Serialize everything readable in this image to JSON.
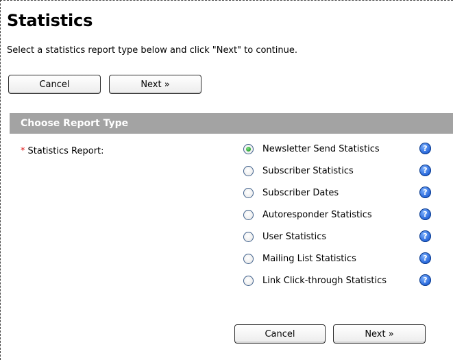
{
  "page": {
    "title": "Statistics",
    "intro": "Select a statistics report type below and click \"Next\" to continue."
  },
  "buttons": {
    "cancel": "Cancel",
    "next": "Next »"
  },
  "section": {
    "header": "Choose Report Type",
    "required_marker": "*",
    "field_label": "Statistics Report:",
    "selected_value": "Newsletter Send Statistics",
    "options": [
      {
        "label": "Newsletter Send Statistics",
        "checked": true
      },
      {
        "label": "Subscriber Statistics",
        "checked": false
      },
      {
        "label": "Subscriber Dates",
        "checked": false
      },
      {
        "label": "Autoresponder Statistics",
        "checked": false
      },
      {
        "label": "User Statistics",
        "checked": false
      },
      {
        "label": "Mailing List Statistics",
        "checked": false
      },
      {
        "label": "Link Click-through Statistics",
        "checked": false
      }
    ],
    "help_glyph": "?"
  },
  "icons": {
    "help": "help-icon",
    "radio": "radio-button"
  },
  "colors": {
    "section_header_bg": "#a3a3a3",
    "required": "#dd1111",
    "help_blue": "#1f5fd6",
    "radio_checked": "#1e9a2a"
  }
}
